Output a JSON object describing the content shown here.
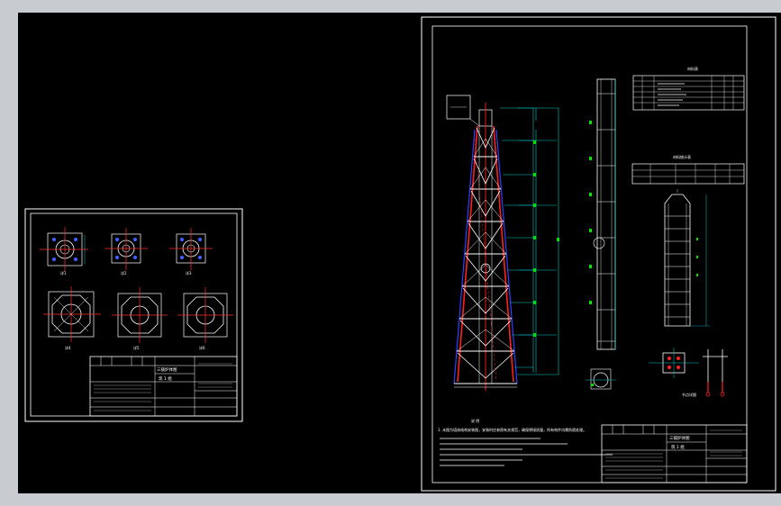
{
  "colors": {
    "background": "#000000",
    "frame": "#ffffff",
    "dimension": "#00c8c8",
    "tower_red": "#ff2020",
    "tower_blue": "#3040ff",
    "center_line": "#ff3030",
    "marker_green": "#00e000",
    "bolt_blue": "#4060ff"
  },
  "left_sheet": {
    "title_block": {
      "project": "三铺炉体图",
      "drawing": "筑 1 组"
    },
    "view_labels": [
      "详1",
      "详2",
      "详3",
      "详4",
      "详5",
      "详6"
    ]
  },
  "right_sheet": {
    "table_label": "材料表",
    "table2_label": "材料统计表",
    "notes_title": "说 明",
    "notes_first_line": "1. 本图为塔体结构安装图，安装时应参照有关规范，确保焊接质量，所有构件均需防腐处理。",
    "detail_label": "节点详图",
    "title_block": {
      "project": "三铺炉体图",
      "drawing": "筑 1 组"
    }
  }
}
